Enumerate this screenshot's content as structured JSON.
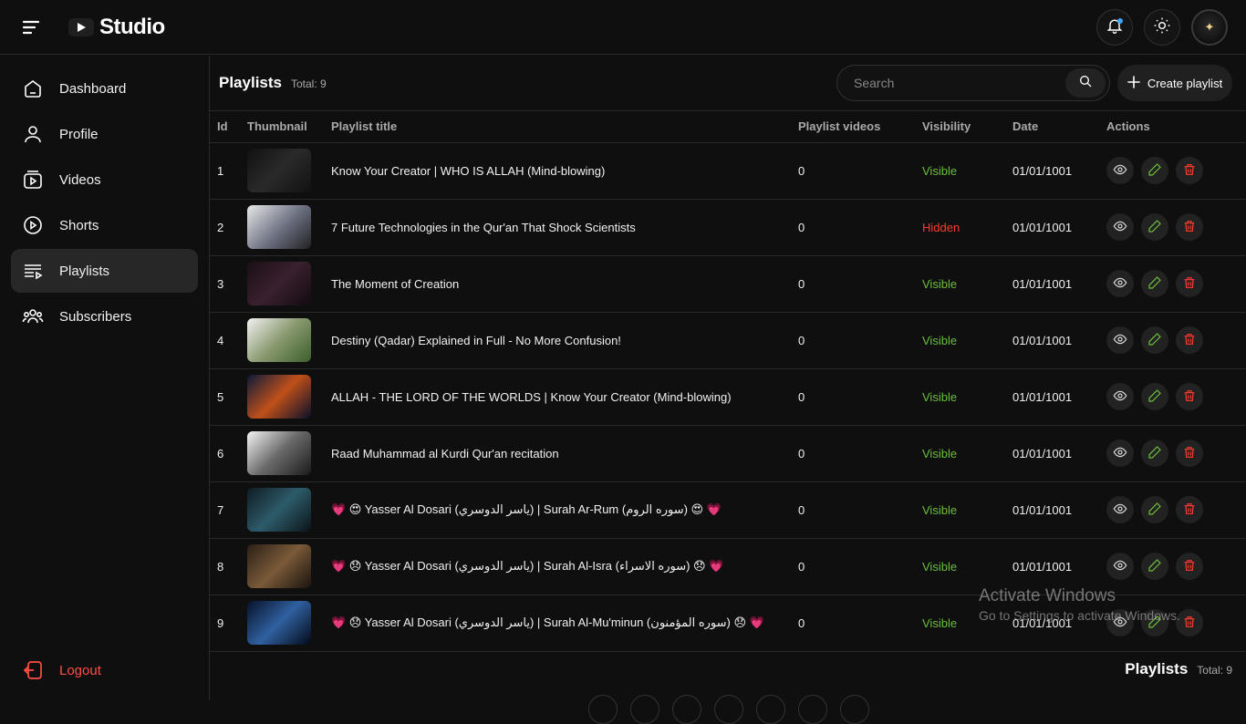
{
  "app": {
    "title": "Studio"
  },
  "sidebar": {
    "items": [
      {
        "label": "Dashboard",
        "icon": "dashboard-icon"
      },
      {
        "label": "Profile",
        "icon": "user-icon"
      },
      {
        "label": "Videos",
        "icon": "videos-icon"
      },
      {
        "label": "Shorts",
        "icon": "shorts-icon"
      },
      {
        "label": "Playlists",
        "icon": "playlist-icon",
        "active": true
      },
      {
        "label": "Subscribers",
        "icon": "subscribers-icon"
      }
    ],
    "logout": "Logout"
  },
  "header": {
    "title": "Playlists",
    "total": "Total: 9",
    "search_placeholder": "Search",
    "create_label": "Create playlist"
  },
  "table": {
    "columns": [
      "Id",
      "Thumbnail",
      "Playlist title",
      "Playlist videos",
      "Visibility",
      "Date",
      "Actions"
    ],
    "rows": [
      {
        "id": "1",
        "title": "Know Your Creator | WHO IS ALLAH (Mind-blowing)",
        "videos": "0",
        "visibility": "Visible",
        "date": "01/01/1001"
      },
      {
        "id": "2",
        "title": "7 Future Technologies in the Qur'an That Shock Scientists",
        "videos": "0",
        "visibility": "Hidden",
        "date": "01/01/1001"
      },
      {
        "id": "3",
        "title": "The Moment of Creation",
        "videos": "0",
        "visibility": "Visible",
        "date": "01/01/1001"
      },
      {
        "id": "4",
        "title": "Destiny (Qadar) Explained in Full - No More Confusion!",
        "videos": "0",
        "visibility": "Visible",
        "date": "01/01/1001"
      },
      {
        "id": "5",
        "title": "ALLAH - THE LORD OF THE WORLDS | Know Your Creator (Mind-blowing)",
        "videos": "0",
        "visibility": "Visible",
        "date": "01/01/1001"
      },
      {
        "id": "6",
        "title": "Raad Muhammad al Kurdi Qur'an recitation",
        "videos": "0",
        "visibility": "Visible",
        "date": "01/01/1001"
      },
      {
        "id": "7",
        "title": "💗 😍 Yasser Al Dosari (ياسر الدوسري) | Surah Ar-Rum (سوره الروم) 😍 💗",
        "videos": "0",
        "visibility": "Visible",
        "date": "01/01/1001"
      },
      {
        "id": "8",
        "title": "💗 😞 Yasser Al Dosari (ياسر الدوسري) | Surah Al-Isra (سوره الاسراء) 😞 💗",
        "videos": "0",
        "visibility": "Visible",
        "date": "01/01/1001"
      },
      {
        "id": "9",
        "title": "💗 😞 Yasser Al Dosari (ياسر الدوسري) | Surah Al-Mu'minun (سوره المؤمنون) 😞 💗",
        "videos": "0",
        "visibility": "Visible",
        "date": "01/01/1001"
      }
    ]
  },
  "footer": {
    "title": "Playlists",
    "total": "Total: 9"
  },
  "watermark": {
    "line1": "Activate Windows",
    "line2": "Go to Settings to activate Windows."
  },
  "colors": {
    "visible": "#6bbf3a",
    "hidden": "#ff3b30",
    "logout": "#ff4e45",
    "accent": "#3ea6ff"
  }
}
